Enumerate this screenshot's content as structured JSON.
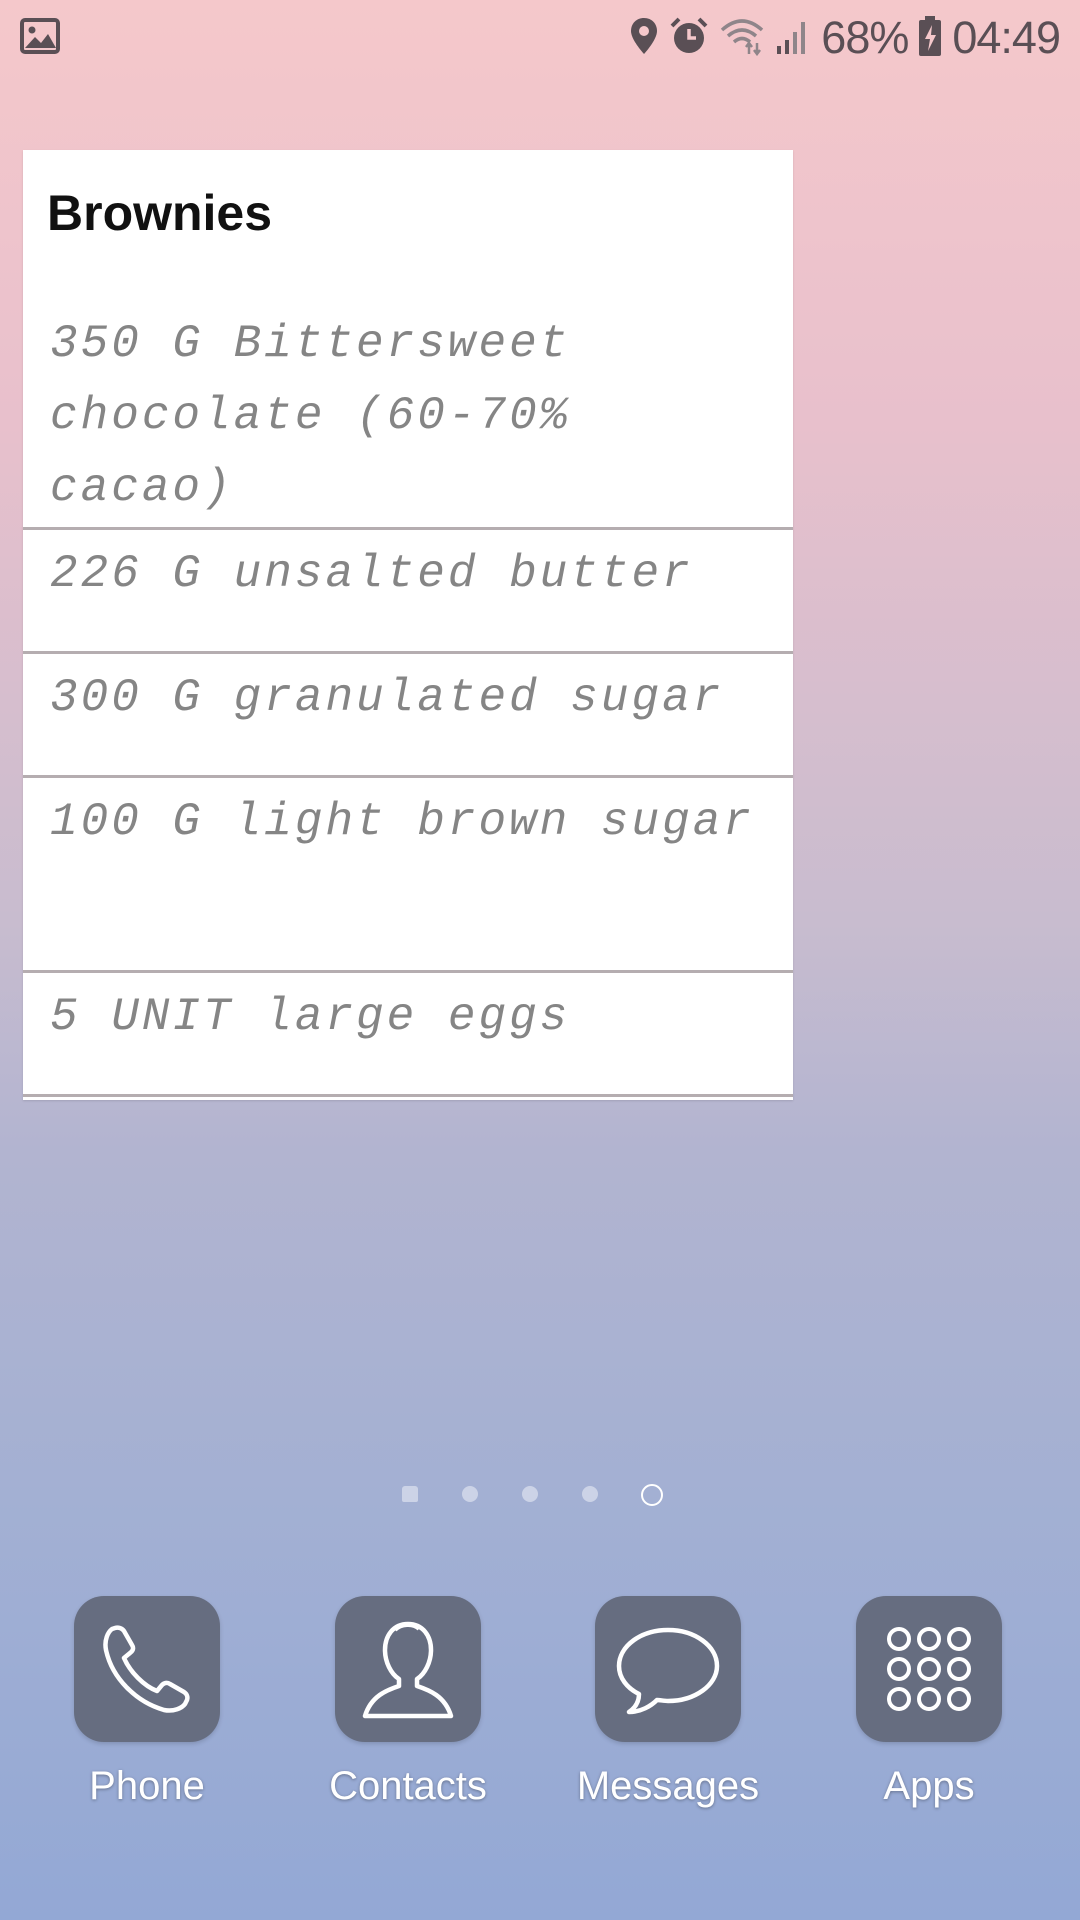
{
  "status_bar": {
    "battery_percent": "68%",
    "time": "04:49",
    "icons": [
      "gallery-notification-icon",
      "location-icon",
      "alarm-icon",
      "wifi-icon",
      "signal-icon",
      "battery-charging-icon"
    ]
  },
  "widget": {
    "title": "Brownies",
    "ingredients": [
      "350 G Bittersweet chocolate (60-70% cacao)",
      "226 G unsalted butter",
      "300 G granulated sugar",
      "100 G light brown sugar",
      "5 UNIT large eggs"
    ]
  },
  "page_indicator": {
    "page_count": 5,
    "active_index": 4
  },
  "dock": {
    "apps": [
      {
        "label": "Phone",
        "icon": "phone-icon"
      },
      {
        "label": "Contacts",
        "icon": "contacts-icon"
      },
      {
        "label": "Messages",
        "icon": "messages-icon"
      },
      {
        "label": "Apps",
        "icon": "apps-grid-icon"
      }
    ]
  },
  "colors": {
    "dock_icon_bg": "#666d80",
    "ingredient_text": "#858585",
    "divider": "#b5adb0",
    "status_text": "#5a4f55"
  }
}
